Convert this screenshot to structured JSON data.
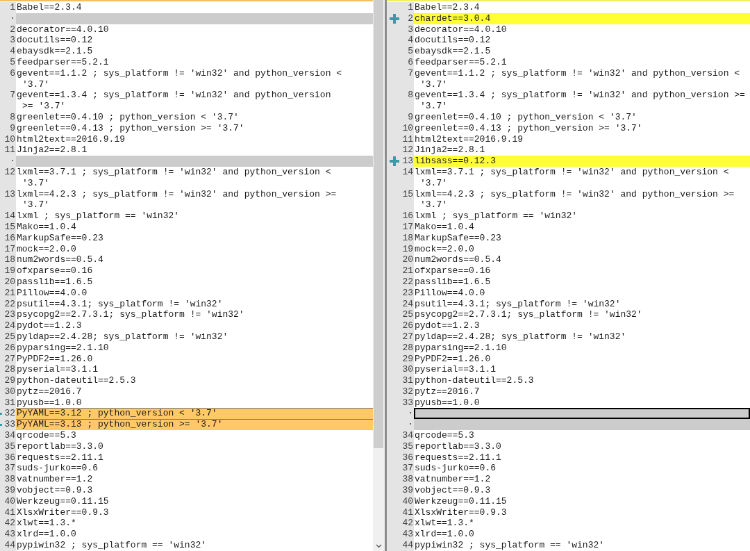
{
  "panes": [
    {
      "lines": [
        {
          "number": "1",
          "text": "Babel==2.3.4",
          "kind": "normal"
        },
        {
          "number": "·",
          "kind": "blank"
        },
        {
          "number": "2",
          "text": "decorator==4.0.10",
          "kind": "normal"
        },
        {
          "number": "3",
          "text": "docutils==0.12",
          "kind": "normal"
        },
        {
          "number": "4",
          "text": "ebaysdk==2.1.5",
          "kind": "normal"
        },
        {
          "number": "5",
          "text": "feedparser==5.2.1",
          "kind": "normal"
        },
        {
          "number": "6",
          "text": "gevent==1.1.2 ; sys_platform != 'win32' and python_version <",
          "continued": "'3.7'",
          "kind": "normal"
        },
        {
          "number": "7",
          "text": "gevent==1.3.4 ; sys_platform != 'win32' and python_version",
          "continued": ">= '3.7'",
          "kind": "normal"
        },
        {
          "number": "8",
          "text": "greenlet==0.4.10 ; python_version < '3.7'",
          "kind": "normal"
        },
        {
          "number": "9",
          "text": "greenlet==0.4.13 ; python_version >= '3.7'",
          "kind": "normal"
        },
        {
          "number": "10",
          "text": "html2text==2016.9.19",
          "kind": "normal"
        },
        {
          "number": "11",
          "text": "Jinja2==2.8.1",
          "kind": "normal"
        },
        {
          "number": "·",
          "kind": "blank"
        },
        {
          "number": "12",
          "text": "lxml==3.7.1 ; sys_platform != 'win32' and python_version <",
          "continued": "'3.7'",
          "kind": "normal"
        },
        {
          "number": "13",
          "text": "lxml==4.2.3 ; sys_platform != 'win32' and python_version >=",
          "continued": "'3.7'",
          "kind": "normal"
        },
        {
          "number": "14",
          "text": "lxml ; sys_platform == 'win32'",
          "kind": "normal"
        },
        {
          "number": "15",
          "text": "Mako==1.0.4",
          "kind": "normal"
        },
        {
          "number": "16",
          "text": "MarkupSafe==0.23",
          "kind": "normal"
        },
        {
          "number": "17",
          "text": "mock==2.0.0",
          "kind": "normal"
        },
        {
          "number": "18",
          "text": "num2words==0.5.4",
          "kind": "normal"
        },
        {
          "number": "19",
          "text": "ofxparse==0.16",
          "kind": "normal"
        },
        {
          "number": "20",
          "text": "passlib==1.6.5",
          "kind": "normal"
        },
        {
          "number": "21",
          "text": "Pillow==4.0.0",
          "kind": "normal"
        },
        {
          "number": "22",
          "text": "psutil==4.3.1; sys_platform != 'win32'",
          "kind": "normal"
        },
        {
          "number": "23",
          "text": "psycopg2==2.7.3.1; sys_platform != 'win32'",
          "kind": "normal"
        },
        {
          "number": "24",
          "text": "pydot==1.2.3",
          "kind": "normal"
        },
        {
          "number": "25",
          "text": "pyldap==2.4.28; sys_platform != 'win32'",
          "kind": "normal"
        },
        {
          "number": "26",
          "text": "pyparsing==2.1.10",
          "kind": "normal"
        },
        {
          "number": "27",
          "text": "PyPDF2==1.26.0",
          "kind": "normal"
        },
        {
          "number": "28",
          "text": "pyserial==3.1.1",
          "kind": "normal"
        },
        {
          "number": "29",
          "text": "python-dateutil==2.5.3",
          "kind": "normal"
        },
        {
          "number": "30",
          "text": "pytz==2016.7",
          "kind": "normal"
        },
        {
          "number": "31",
          "text": "pyusb==1.0.0",
          "kind": "normal"
        },
        {
          "number": "32",
          "text": "PyYAML==3.12 ; python_version < '3.7'",
          "kind": "changed"
        },
        {
          "number": "33",
          "text": "PyYAML==3.13 ; python_version >= '3.7'",
          "kind": "changed"
        },
        {
          "number": "34",
          "text": "qrcode==5.3",
          "kind": "normal"
        },
        {
          "number": "35",
          "text": "reportlab==3.3.0",
          "kind": "normal"
        },
        {
          "number": "36",
          "text": "requests==2.11.1",
          "kind": "normal"
        },
        {
          "number": "37",
          "text": "suds-jurko==0.6",
          "kind": "normal"
        },
        {
          "number": "38",
          "text": "vatnumber==1.2",
          "kind": "normal"
        },
        {
          "number": "39",
          "text": "vobject==0.9.3",
          "kind": "normal"
        },
        {
          "number": "40",
          "text": "Werkzeug==0.11.15",
          "kind": "normal"
        },
        {
          "number": "41",
          "text": "XlsxWriter==0.9.3",
          "kind": "normal"
        },
        {
          "number": "42",
          "text": "xlwt==1.3.*",
          "kind": "normal"
        },
        {
          "number": "43",
          "text": "xlrd==1.0.0",
          "kind": "normal"
        },
        {
          "number": "44",
          "text": "pypiwin32 ; sys_platform == 'win32'",
          "kind": "normal"
        }
      ]
    },
    {
      "lines": [
        {
          "number": "1",
          "text": "Babel==2.3.4",
          "kind": "normal"
        },
        {
          "number": "2",
          "text": "chardet==3.0.4",
          "kind": "added"
        },
        {
          "number": "3",
          "text": "decorator==4.0.10",
          "kind": "normal"
        },
        {
          "number": "4",
          "text": "docutils==0.12",
          "kind": "normal"
        },
        {
          "number": "5",
          "text": "ebaysdk==2.1.5",
          "kind": "normal"
        },
        {
          "number": "6",
          "text": "feedparser==5.2.1",
          "kind": "normal"
        },
        {
          "number": "7",
          "text": "gevent==1.1.2 ; sys_platform != 'win32' and python_version <",
          "continued": "'3.7'",
          "kind": "normal"
        },
        {
          "number": "8",
          "text": "gevent==1.3.4 ; sys_platform != 'win32' and python_version >=",
          "continued": "'3.7'",
          "kind": "normal"
        },
        {
          "number": "9",
          "text": "greenlet==0.4.10 ; python_version < '3.7'",
          "kind": "normal"
        },
        {
          "number": "10",
          "text": "greenlet==0.4.13 ; python_version >= '3.7'",
          "kind": "normal"
        },
        {
          "number": "11",
          "text": "html2text==2016.9.19",
          "kind": "normal"
        },
        {
          "number": "12",
          "text": "Jinja2==2.8.1",
          "kind": "normal"
        },
        {
          "number": "13",
          "text": "libsass==0.12.3",
          "kind": "added"
        },
        {
          "number": "14",
          "text": "lxml==3.7.1 ; sys_platform != 'win32' and python_version <",
          "continued": "'3.7'",
          "kind": "normal"
        },
        {
          "number": "15",
          "text": "lxml==4.2.3 ; sys_platform != 'win32' and python_version >=",
          "continued": "'3.7'",
          "kind": "normal"
        },
        {
          "number": "16",
          "text": "lxml ; sys_platform == 'win32'",
          "kind": "normal"
        },
        {
          "number": "17",
          "text": "Mako==1.0.4",
          "kind": "normal"
        },
        {
          "number": "18",
          "text": "MarkupSafe==0.23",
          "kind": "normal"
        },
        {
          "number": "19",
          "text": "mock==2.0.0",
          "kind": "normal"
        },
        {
          "number": "20",
          "text": "num2words==0.5.4",
          "kind": "normal"
        },
        {
          "number": "21",
          "text": "ofxparse==0.16",
          "kind": "normal"
        },
        {
          "number": "22",
          "text": "passlib==1.6.5",
          "kind": "normal"
        },
        {
          "number": "23",
          "text": "Pillow==4.0.0",
          "kind": "normal"
        },
        {
          "number": "24",
          "text": "psutil==4.3.1; sys_platform != 'win32'",
          "kind": "normal"
        },
        {
          "number": "25",
          "text": "psycopg2==2.7.3.1; sys_platform != 'win32'",
          "kind": "normal"
        },
        {
          "number": "26",
          "text": "pydot==1.2.3",
          "kind": "normal"
        },
        {
          "number": "27",
          "text": "pyldap==2.4.28; sys_platform != 'win32'",
          "kind": "normal"
        },
        {
          "number": "28",
          "text": "pyparsing==2.1.10",
          "kind": "normal"
        },
        {
          "number": "29",
          "text": "PyPDF2==1.26.0",
          "kind": "normal"
        },
        {
          "number": "30",
          "text": "pyserial==3.1.1",
          "kind": "normal"
        },
        {
          "number": "31",
          "text": "python-dateutil==2.5.3",
          "kind": "normal"
        },
        {
          "number": "32",
          "text": "pytz==2016.7",
          "kind": "normal"
        },
        {
          "number": "33",
          "text": "pyusb==1.0.0",
          "kind": "normal"
        },
        {
          "number": "·",
          "kind": "blank",
          "focused": true
        },
        {
          "number": "·",
          "kind": "blank",
          "focused": false
        },
        {
          "number": "34",
          "text": "qrcode==5.3",
          "kind": "normal"
        },
        {
          "number": "35",
          "text": "reportlab==3.3.0",
          "kind": "normal"
        },
        {
          "number": "36",
          "text": "requests==2.11.1",
          "kind": "normal"
        },
        {
          "number": "37",
          "text": "suds-jurko==0.6",
          "kind": "normal"
        },
        {
          "number": "38",
          "text": "vatnumber==1.2",
          "kind": "normal"
        },
        {
          "number": "39",
          "text": "vobject==0.9.3",
          "kind": "normal"
        },
        {
          "number": "40",
          "text": "Werkzeug==0.11.15",
          "kind": "normal"
        },
        {
          "number": "41",
          "text": "XlsxWriter==0.9.3",
          "kind": "normal"
        },
        {
          "number": "42",
          "text": "xlwt==1.3.*",
          "kind": "normal"
        },
        {
          "number": "43",
          "text": "xlrd==1.0.0",
          "kind": "normal"
        },
        {
          "number": "44",
          "text": "pypiwin32 ; sys_platform == 'win32'",
          "kind": "normal"
        }
      ]
    }
  ]
}
